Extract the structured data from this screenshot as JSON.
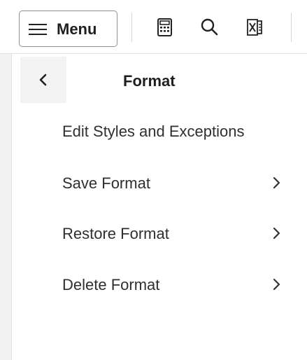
{
  "toolbar": {
    "menu_label": "Menu",
    "icons": [
      "calculator-icon",
      "search-icon",
      "excel-export-icon"
    ]
  },
  "panel": {
    "title": "Format",
    "back_icon": "chevron-left-icon",
    "items": [
      {
        "label": "Edit Styles and Exceptions",
        "has_submenu": false
      },
      {
        "label": "Save Format",
        "has_submenu": true
      },
      {
        "label": "Restore Format",
        "has_submenu": true
      },
      {
        "label": "Delete Format",
        "has_submenu": true
      }
    ]
  },
  "colors": {
    "background": "#f1f1f1",
    "panel": "#ffffff",
    "text": "#2f2f2f",
    "border": "#8f8f8f"
  }
}
